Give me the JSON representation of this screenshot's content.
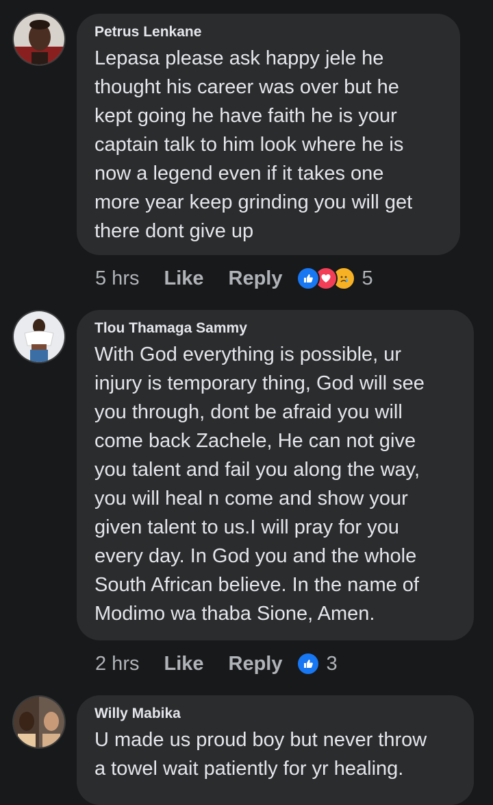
{
  "comments": [
    {
      "author": "Petrus Lenkane",
      "text": "Lepasa please ask happy jele he\nthought his career was over but he\nkept going he have faith he is your\ncaptain talk to him look where he is\nnow a legend even if it takes one\nmore year keep grinding you will get\nthere dont give up",
      "time": "5 hrs",
      "like_label": "Like",
      "reply_label": "Reply",
      "reactions": [
        "like",
        "love",
        "sad"
      ],
      "reaction_count": "5"
    },
    {
      "author": "Tlou Thamaga Sammy",
      "text": "With God everything is possible, ur\ninjury is temporary thing, God will see\nyou through, dont be afraid you will\ncome back Zachele, He can not give\nyou talent and fail you along the way,\nyou will heal n come and show your\ngiven talent to us.I will pray for you\nevery day. In God you and the whole\nSouth African believe. In the name of\nModimo wa thaba Sione, Amen.",
      "time": "2 hrs",
      "like_label": "Like",
      "reply_label": "Reply",
      "reactions": [
        "like"
      ],
      "reaction_count": "3"
    },
    {
      "author": "Willy Mabika",
      "text": "U made us proud boy but never throw\na towel wait patiently for yr healing."
    }
  ],
  "colors": {
    "background": "#18191a",
    "bubble": "#2b2c2e",
    "like_blue": "#1877f2",
    "love_red": "#f33e58",
    "sad_yellow": "#f7b125"
  }
}
